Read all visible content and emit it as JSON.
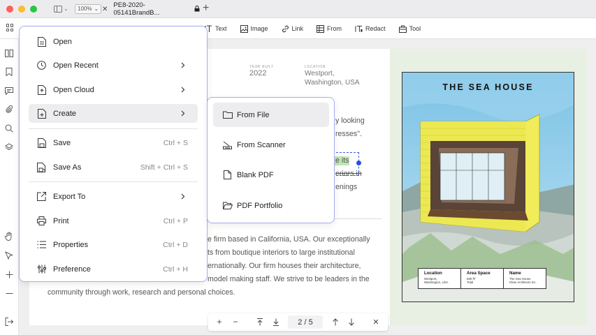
{
  "window": {
    "zoom_value": "100%",
    "tab_title": "PE8-2020-05141BrandB...",
    "tab_close": "✕",
    "new_tab": "+"
  },
  "toolbar": {
    "tools": [
      {
        "label": "Text"
      },
      {
        "label": "Image"
      },
      {
        "label": "Link"
      },
      {
        "label": "From"
      },
      {
        "label": "Redact"
      },
      {
        "label": "Tool"
      }
    ]
  },
  "document": {
    "year_built_label": "YEAR BUILT",
    "year_built_value": "2022",
    "location_label": "LOCATION",
    "location_value_1": "Westport,",
    "location_value_2": "Washington, USA",
    "frag_1": "y looking",
    "frag_2": "resses\".",
    "frag_3": "e its",
    "frag_4": "eriors in",
    "frag_5": "enings",
    "para_1": "e firm based in California, USA. Our exceptionally",
    "para_2": "ts from boutique interiors to large institutional",
    "para_3": "ernationally. Our firm houses their architecture,",
    "para_4": "model making staff. We strive to be leaders in the",
    "para_5": "community through work, research and personal choices."
  },
  "poster": {
    "title": "THE SEA HOUSE",
    "location_h": "Location",
    "location_v1": "Westport,",
    "location_v2": "Washington, USA",
    "area_h": "Area Space",
    "area_v1": "500 ft²",
    "area_v2": "Total",
    "name_h": "Name",
    "name_v1": "The Sea House",
    "name_v2": "Khan Architects Inc."
  },
  "menu": {
    "items": [
      {
        "label": "Open",
        "shortcut": ""
      },
      {
        "label": "Open Recent",
        "shortcut": ""
      },
      {
        "label": "Open Cloud",
        "shortcut": ""
      },
      {
        "label": "Create",
        "shortcut": ""
      },
      {
        "label": "Save",
        "shortcut": "Ctrl + S"
      },
      {
        "label": "Save As",
        "shortcut": "Shift + Ctrl + S"
      },
      {
        "label": "Export To",
        "shortcut": ""
      },
      {
        "label": "Print",
        "shortcut": "Ctrl + P"
      },
      {
        "label": "Properties",
        "shortcut": "Ctrl + D"
      },
      {
        "label": "Preference",
        "shortcut": "Ctrl + H"
      }
    ]
  },
  "submenu": {
    "items": [
      {
        "label": "From File"
      },
      {
        "label": "From Scanner"
      },
      {
        "label": "Blank PDF"
      },
      {
        "label": "PDF Portfolio"
      }
    ]
  },
  "pagenav": {
    "plus": "+",
    "minus": "−",
    "page_indicator": "2 / 5",
    "close": "✕"
  },
  "colors": {
    "menu_border": "#a8acf0",
    "selection_blue": "#2a4fd8",
    "highlight_green": "#bfe6b5",
    "poster_yellow": "#f0ec5a"
  }
}
